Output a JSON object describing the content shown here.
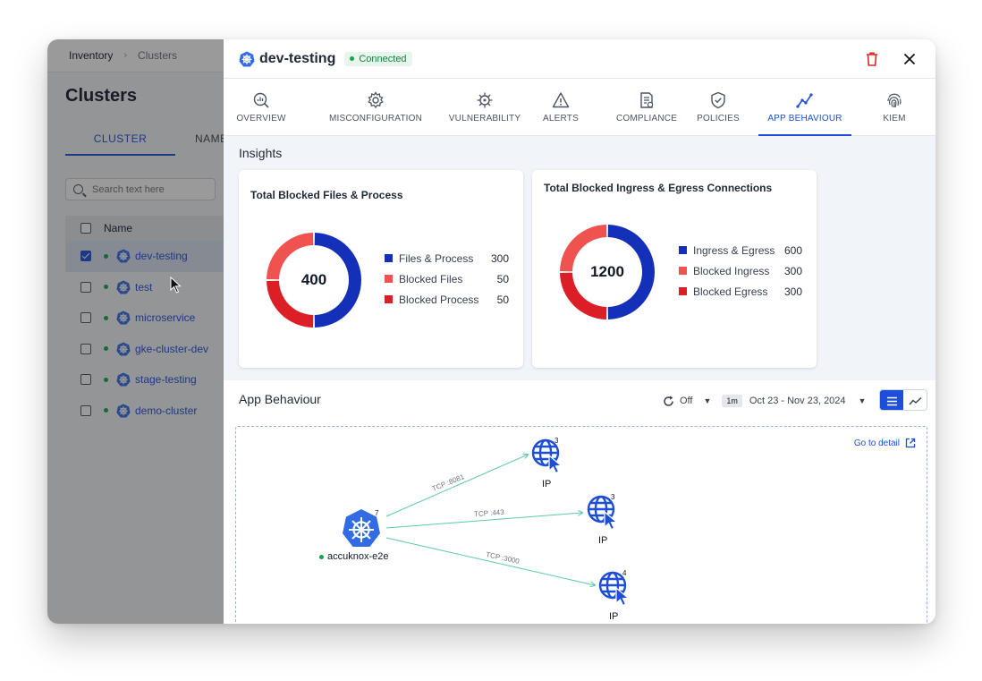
{
  "background": {
    "breadcrumb": [
      "Inventory",
      "Clusters"
    ],
    "page_title": "Clusters",
    "tabs": [
      "CLUSTER",
      "NAME"
    ],
    "search_placeholder": "Search text here",
    "table_header": "Name",
    "clusters": [
      {
        "name": "dev-testing",
        "checked": true
      },
      {
        "name": "test",
        "checked": false
      },
      {
        "name": "microservice",
        "checked": false
      },
      {
        "name": "gke-cluster-dev",
        "checked": false
      },
      {
        "name": "stage-testing",
        "checked": false
      },
      {
        "name": "demo-cluster",
        "checked": false
      }
    ]
  },
  "drawer": {
    "title": "dev-testing",
    "status": "Connected",
    "tabs": [
      {
        "label": "OVERVIEW",
        "icon": "overview-icon"
      },
      {
        "label": "MISCONFIGURATION",
        "icon": "gear-icon"
      },
      {
        "label": "VULNERABILITY",
        "icon": "virus-icon"
      },
      {
        "label": "ALERTS",
        "icon": "warning-icon"
      },
      {
        "label": "COMPLIANCE",
        "icon": "compliance-icon"
      },
      {
        "label": "POLICIES",
        "icon": "shield-icon"
      },
      {
        "label": "APP BEHAVIOUR",
        "icon": "trend-icon",
        "active": true
      },
      {
        "label": "KIEM",
        "icon": "fingerprint-icon"
      }
    ],
    "insights_title": "Insights",
    "cards": [
      {
        "title": "Total Blocked Files & Process",
        "total": "400",
        "items": [
          {
            "label": "Files & Process",
            "value": "300",
            "color": "#1530b8"
          },
          {
            "label": "Blocked Files",
            "value": "50",
            "color": "#f0524f"
          },
          {
            "label": "Blocked Process",
            "value": "50",
            "color": "#dc1f26"
          }
        ],
        "segments": [
          {
            "fraction": 0.5,
            "color": "#1530b8"
          },
          {
            "fraction": 0.25,
            "color": "#dc1f26"
          },
          {
            "fraction": 0.25,
            "color": "#f0524f"
          }
        ]
      },
      {
        "title": "Total Blocked Ingress & Egress Connections",
        "total": "1200",
        "items": [
          {
            "label": "Ingress & Egress",
            "value": "600",
            "color": "#1530b8"
          },
          {
            "label": "Blocked Ingress",
            "value": "300",
            "color": "#f0524f"
          },
          {
            "label": "Blocked Egress",
            "value": "300",
            "color": "#dc1f26"
          }
        ],
        "segments": [
          {
            "fraction": 0.5,
            "color": "#1530b8"
          },
          {
            "fraction": 0.25,
            "color": "#dc1f26"
          },
          {
            "fraction": 0.25,
            "color": "#f0524f"
          }
        ]
      }
    ],
    "app_behaviour": {
      "title": "App Behaviour",
      "refresh": "Off",
      "range_chip": "1m",
      "date_range": "Oct 23 - Nov 23, 2024",
      "go_to_detail": "Go to detail",
      "source": {
        "name": "accuknox-e2e",
        "count": "7"
      },
      "targets": [
        {
          "label": "IP",
          "count": "3",
          "edge": "TCP :8081"
        },
        {
          "label": "IP",
          "count": "3",
          "edge": "TCP :443"
        },
        {
          "label": "IP",
          "count": "4",
          "edge": "TCP :3000"
        }
      ]
    }
  }
}
